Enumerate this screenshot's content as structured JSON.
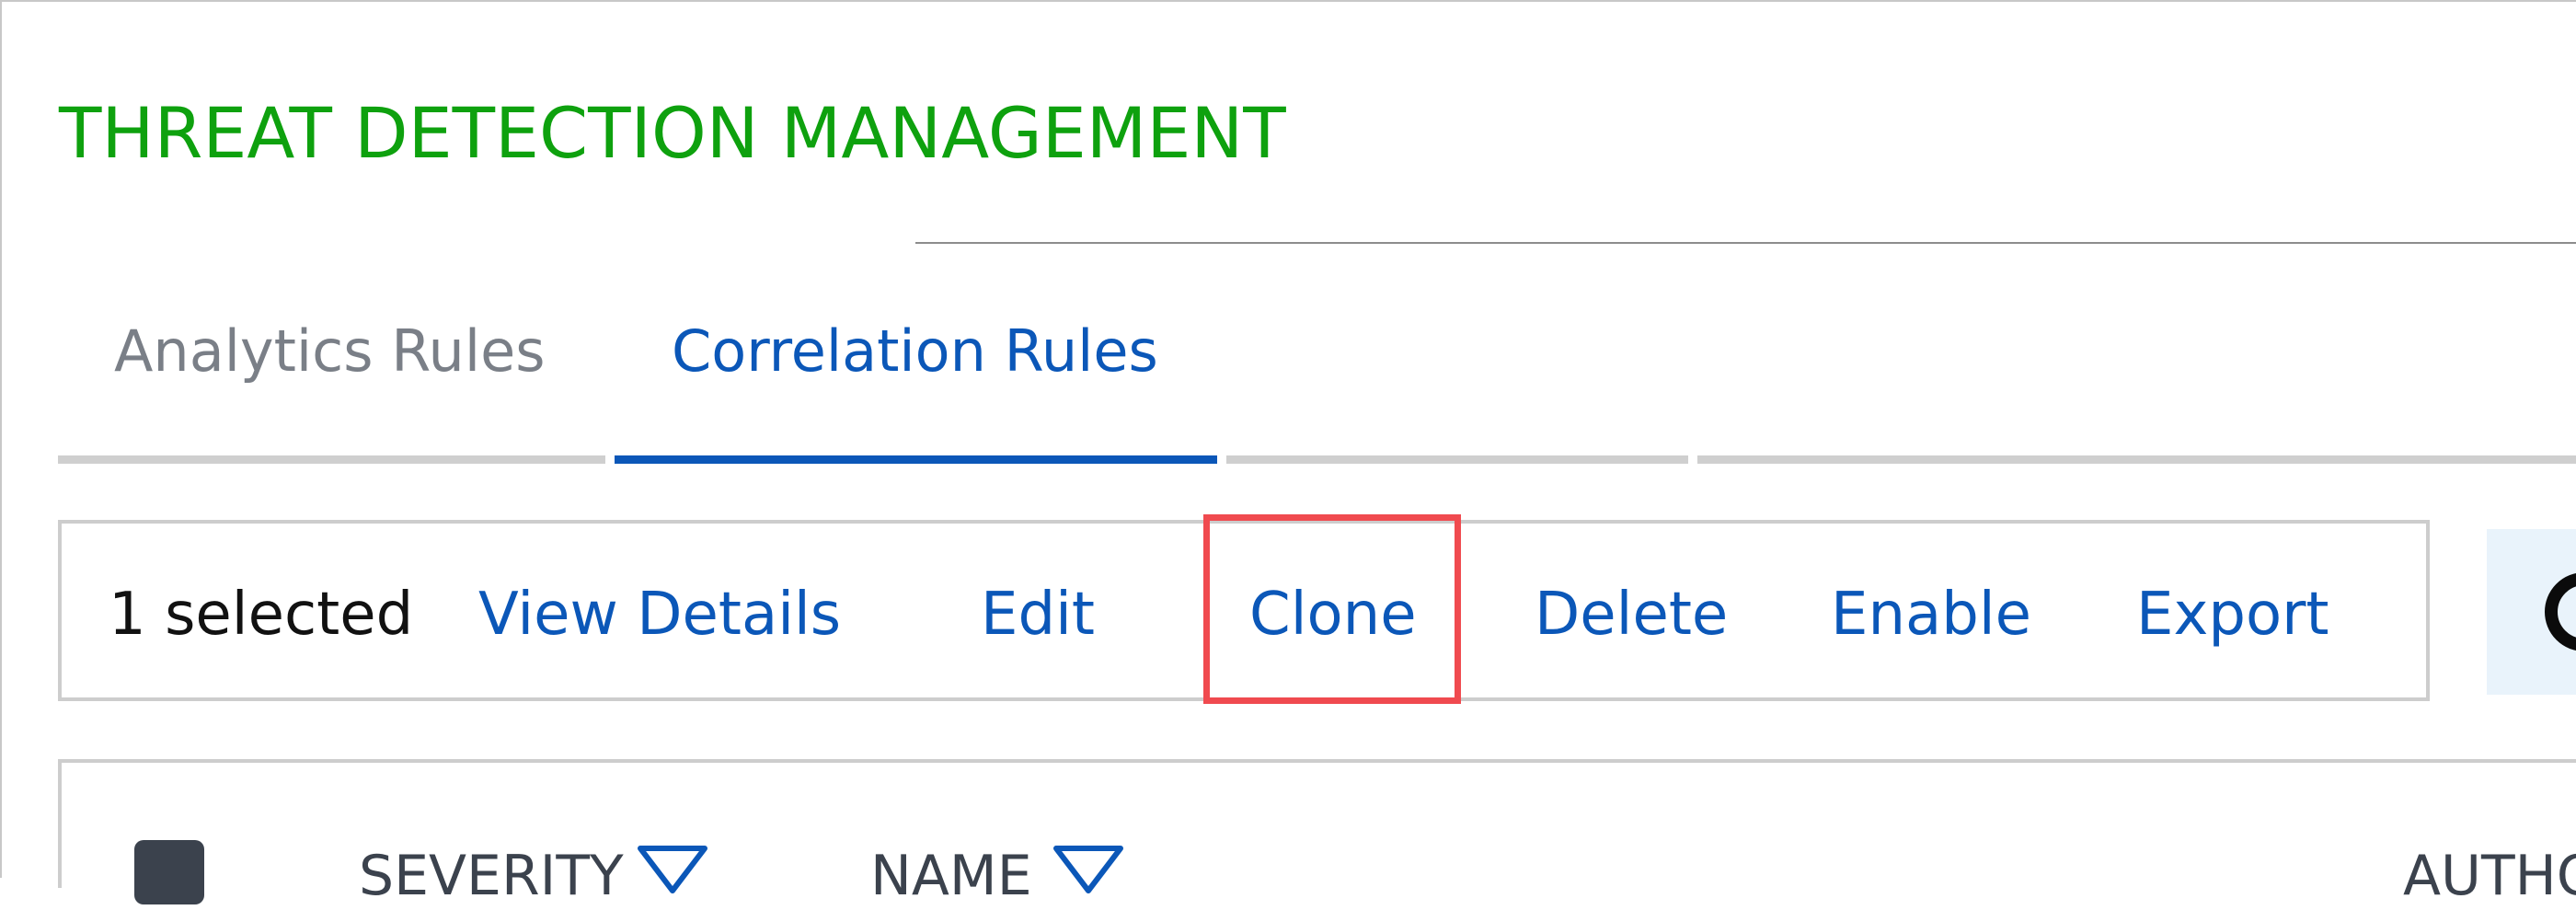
{
  "header": {
    "title": "THREAT DETECTION MANAGEMENT"
  },
  "tabs": [
    {
      "label": "Analytics Rules",
      "active": false
    },
    {
      "label": "Correlation Rules",
      "active": true
    }
  ],
  "toolbar": {
    "selected_count": "1 selected",
    "actions": [
      "View Details",
      "Edit",
      "Clone",
      "Delete",
      "Enable",
      "Export"
    ],
    "highlighted_action": "Clone"
  },
  "table": {
    "columns": [
      "SEVERITY",
      "NAME",
      "AUTHOR"
    ]
  },
  "colors": {
    "title": "#0ea10e",
    "link": "#0b57b8",
    "active_tab_bar": "#0b57b8",
    "highlight": "#f04a4f"
  }
}
